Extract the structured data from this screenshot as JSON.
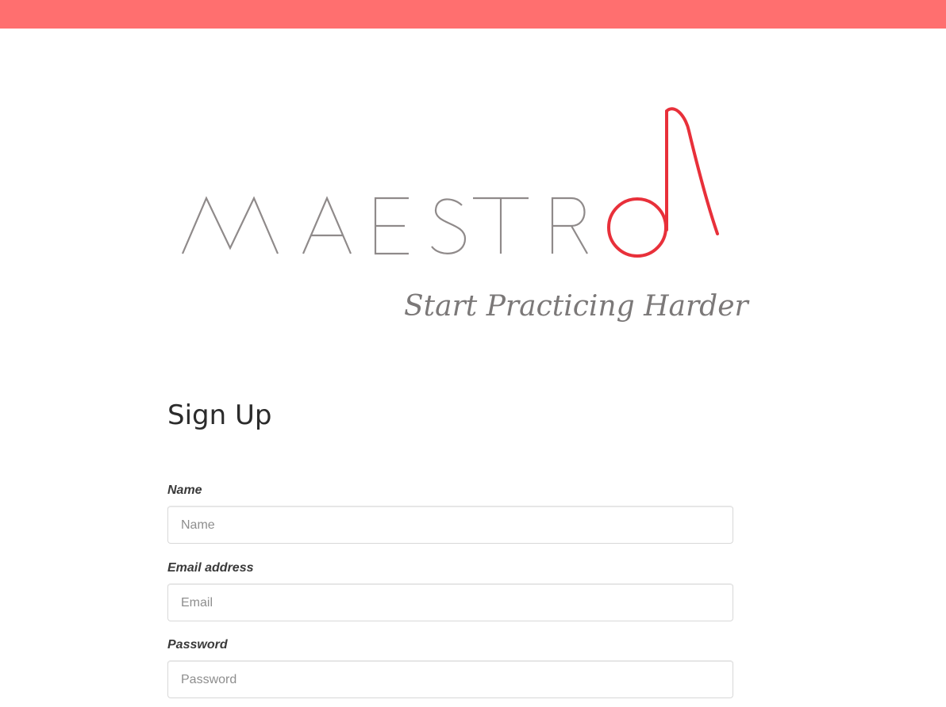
{
  "header": {
    "bar_color": "#ff6f6f"
  },
  "logo": {
    "wordmark": "MAESTRO",
    "tagline": "Start Practicing Harder",
    "text_color": "#8f8a8a",
    "note_color": "#e8303a"
  },
  "form": {
    "title": "Sign Up",
    "fields": [
      {
        "label": "Name",
        "placeholder": "Name",
        "value": ""
      },
      {
        "label": "Email address",
        "placeholder": "Email",
        "value": ""
      },
      {
        "label": "Password",
        "placeholder": "Password",
        "value": ""
      }
    ]
  }
}
